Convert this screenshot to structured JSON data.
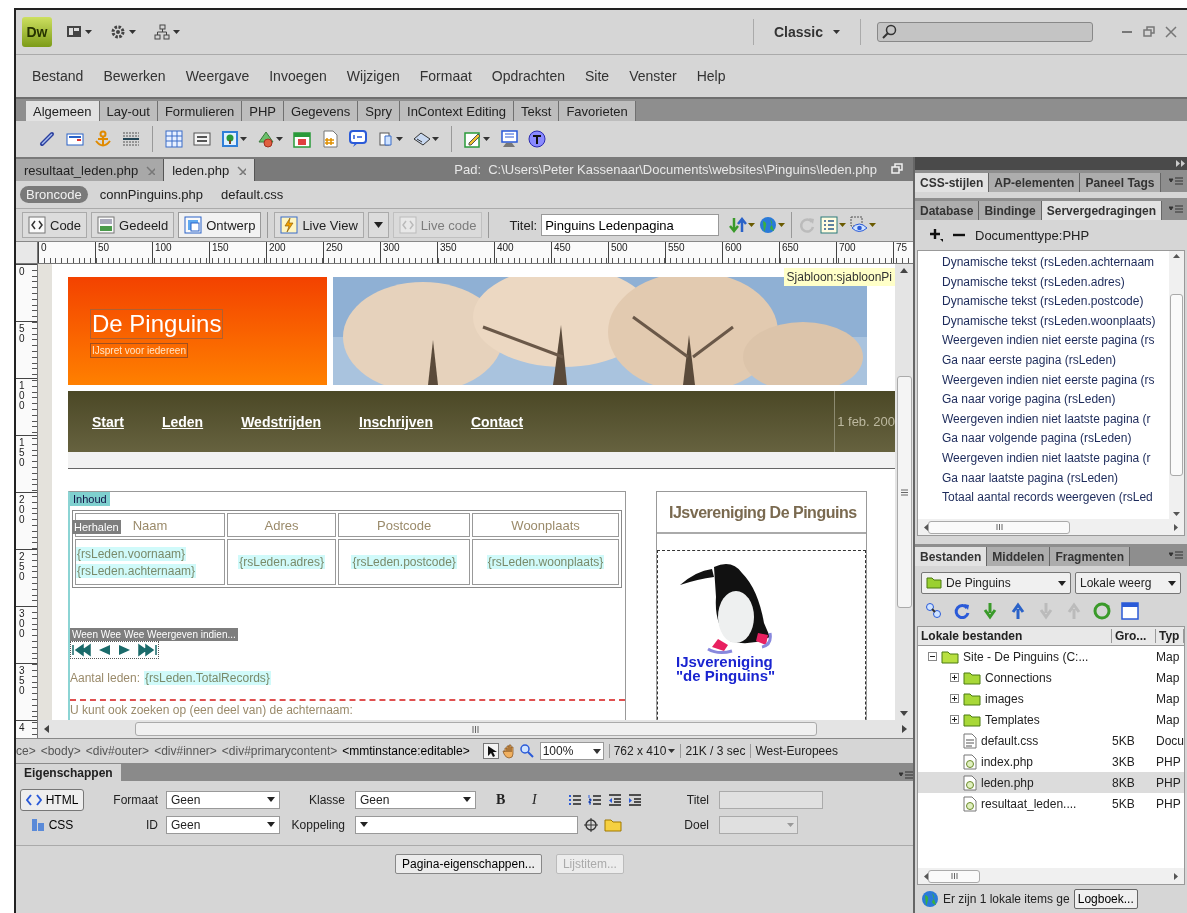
{
  "app": {
    "logo": "Dw",
    "workspace": "Classic"
  },
  "menu": [
    "Bestand",
    "Bewerken",
    "Weergave",
    "Invoegen",
    "Wijzigen",
    "Formaat",
    "Opdrachten",
    "Site",
    "Venster",
    "Help"
  ],
  "insert_tabs": [
    {
      "label": "Algemeen",
      "selected": true
    },
    {
      "label": "Lay-out",
      "selected": false
    },
    {
      "label": "Formulieren",
      "selected": false
    },
    {
      "label": "PHP",
      "selected": false
    },
    {
      "label": "Gegevens",
      "selected": false
    },
    {
      "label": "Spry",
      "selected": false
    },
    {
      "label": "InContext Editing",
      "selected": false
    },
    {
      "label": "Tekst",
      "selected": false
    },
    {
      "label": "Favorieten",
      "selected": false
    }
  ],
  "documents": [
    {
      "label": "resultaat_leden.php",
      "selected": false
    },
    {
      "label": "leden.php",
      "selected": true
    }
  ],
  "path": "Pad:  C:\\Users\\Peter Kassenaar\\Documents\\websites\\Pinguins\\leden.php",
  "related_files": [
    {
      "label": "Broncode",
      "selected": true
    },
    {
      "label": "connPinguins.php",
      "selected": false
    },
    {
      "label": "default.css",
      "selected": false
    }
  ],
  "view_buttons": [
    {
      "label": "Code",
      "selected": false
    },
    {
      "label": "Gedeeld",
      "selected": false
    },
    {
      "label": "Ontwerp",
      "selected": true
    }
  ],
  "live_buttons": [
    {
      "label": "Live View",
      "disabled": false
    },
    {
      "label": "Live code",
      "disabled": true
    }
  ],
  "title_field": {
    "label": "Titel:",
    "value": "Pinguins Ledenpagina"
  },
  "ruler": {
    "h": [
      "0",
      "50",
      "100",
      "150",
      "200",
      "250",
      "300",
      "350",
      "400",
      "450",
      "500",
      "550",
      "600",
      "650",
      "700",
      "75"
    ],
    "v": [
      "0",
      "50",
      "100",
      "150",
      "200",
      "250",
      "300",
      "350",
      "4"
    ]
  },
  "design": {
    "template_label": "Sjabloon:sjabloonPi",
    "site_title": "De Pinguins",
    "tagline": "IJspret voor iedereen",
    "nav": [
      "Start",
      "Leden",
      "Wedstrijden",
      "Inschrijven",
      "Contact"
    ],
    "date": "1 feb. 200",
    "region_label": "Inhoud",
    "repeat_label": "Herhalen",
    "columns": [
      "Naam",
      "Adres",
      "Postcode",
      "Woonplaats"
    ],
    "row": [
      [
        "{rsLeden.voornaam}",
        "{rsLeden.achternaam}"
      ],
      [
        "{rsLeden.adres}"
      ],
      [
        "{rsLeden.postcode}"
      ],
      [
        "{rsLeden.woonplaats}"
      ]
    ],
    "pager_label": "Ween Wee Wee Weergeven indien...",
    "count_label": "Aantal leden:",
    "count_value": "{rsLeden.TotalRecords}",
    "search_text": "U kunt ook zoeken op (een deel van) de achternaam:",
    "sidebar_title": "IJsvereniging De Pinguins",
    "logo_caption": [
      "IJsvereniging",
      "\"de Pinguins\""
    ]
  },
  "tag_selector": [
    {
      "label": "ce>",
      "selected": false
    },
    {
      "label": "<body>",
      "selected": false
    },
    {
      "label": "<div#outer>",
      "selected": false
    },
    {
      "label": "<div#inner>",
      "selected": false
    },
    {
      "label": "<div#primarycontent>",
      "selected": false
    },
    {
      "label": "<mmtinstance:editable>",
      "selected": true
    }
  ],
  "status": {
    "zoom": "100%",
    "size": "762 x 410",
    "weight": "21K / 3 sec",
    "encoding": "West-Europees"
  },
  "properties": {
    "title": "Eigenschappen",
    "modes": [
      {
        "label": "HTML",
        "selected": true
      },
      {
        "label": "CSS",
        "selected": false
      }
    ],
    "format": {
      "label": "Formaat",
      "value": "Geen"
    },
    "class": {
      "label": "Klasse",
      "value": "Geen"
    },
    "id": {
      "label": "ID",
      "value": "Geen"
    },
    "link": {
      "label": "Koppeling"
    },
    "title_field": {
      "label": "Titel",
      "disabled": true
    },
    "target": {
      "label": "Doel",
      "disabled": true
    },
    "styles": [
      "B",
      "I"
    ],
    "buttons": [
      {
        "label": "Pagina-eigenschappen...",
        "disabled": false
      },
      {
        "label": "Lijstitem...",
        "disabled": true
      }
    ]
  },
  "panel_tabs": [
    {
      "label": "CSS-stijlen",
      "selected": true
    },
    {
      "label": "AP-elementen",
      "selected": false
    },
    {
      "label": "Paneel Tags",
      "selected": false
    }
  ],
  "server_tabs": [
    {
      "label": "Database",
      "selected": false
    },
    {
      "label": "Bindinge",
      "selected": false
    },
    {
      "label": "Servergedragingen",
      "selected": true
    }
  ],
  "doc_type": "Documenttype:PHP",
  "behaviors": [
    "Dynamische tekst (rsLeden.achternaam",
    "Dynamische tekst (rsLeden.adres)",
    "Dynamische tekst (rsLeden.postcode)",
    "Dynamische tekst (rsLeden.woonplaats)",
    "Weergeven indien niet eerste pagina (rs",
    "Ga naar eerste pagina (rsLeden)",
    "Weergeven indien niet eerste pagina (rs",
    "Ga naar vorige pagina (rsLeden)",
    "Weergeven indien niet laatste pagina (r",
    "Ga naar volgende pagina (rsLeden)",
    "Weergeven indien niet laatste pagina (r",
    "Ga naar laatste pagina (rsLeden)",
    "Totaal aantal records weergeven (rsLed"
  ],
  "files": {
    "tabs": [
      {
        "label": "Bestanden",
        "selected": true
      },
      {
        "label": "Middelen",
        "selected": false
      },
      {
        "label": "Fragmenten",
        "selected": false
      }
    ],
    "site": "De Pinguins",
    "view": "Lokale weerg",
    "columns": [
      "Lokale bestanden",
      "Gro...",
      "Typ"
    ],
    "tree": [
      {
        "name": "Site - De Pinguins (C:...",
        "type": "Map",
        "kind": "site",
        "expanded": true,
        "selected": false,
        "children": [
          {
            "name": "Connections",
            "type": "Map",
            "kind": "folder",
            "expanded": false,
            "selected": false
          },
          {
            "name": "images",
            "type": "Map",
            "kind": "folder",
            "expanded": false,
            "selected": false
          },
          {
            "name": "Templates",
            "type": "Map",
            "kind": "folder",
            "expanded": false,
            "selected": false
          },
          {
            "name": "default.css",
            "size": "5KB",
            "type": "Docu",
            "kind": "css",
            "selected": false
          },
          {
            "name": "index.php",
            "size": "3KB",
            "type": "PHP",
            "kind": "php",
            "selected": false
          },
          {
            "name": "leden.php",
            "size": "8KB",
            "type": "PHP",
            "kind": "php",
            "selected": true
          },
          {
            "name": "resultaat_leden....",
            "size": "5KB",
            "type": "PHP",
            "kind": "php",
            "selected": false
          }
        ]
      }
    ],
    "status": "Er zijn 1 lokale items ge",
    "log_button": "Logboek..."
  }
}
